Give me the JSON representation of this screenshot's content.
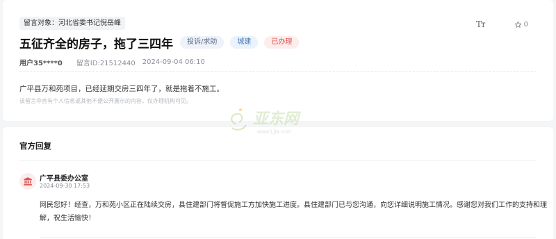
{
  "message": {
    "target_label": "留言对象：河北省委书记倪岳峰",
    "title": "五征齐全的房子，拖了三四年",
    "badges": {
      "type": "投诉/求助",
      "category": "城建",
      "status": "已办理"
    },
    "user": "用户35****0",
    "message_id": "留言ID:21512440",
    "datetime": "2024-09-04 06:10",
    "content": "广平县万和苑项目，已经延期交房三四年了，就是拖着不施工。",
    "privacy_notice": "该留言中含有个人信息或其他不便公开展示的内容，仅办理机构可见。",
    "tools": {
      "font_size_icon": "Tт",
      "star_count": "0"
    }
  },
  "watermark": {
    "brand": "亚东网",
    "domain": "www.Ljia.com"
  },
  "reply": {
    "section_title": "官方回复",
    "org_name": "广平县委办公室",
    "datetime": "2024-09-30 17:53",
    "text": "网民您好！经查，万和苑小区正在陆续交房，县住建部门将督促施工方加快施工进度。县住建部门已与您沟通，向您详细说明施工情况。感谢您对我们工作的支持和理解，祝生活愉快！"
  },
  "icons": {
    "font_size": "font-size-icon",
    "star": "star-icon",
    "avatar": "government-building-icon"
  },
  "colors": {
    "status_red": "#e05252",
    "category_blue": "#4a7db8",
    "page_background": "#f4f5f7"
  }
}
